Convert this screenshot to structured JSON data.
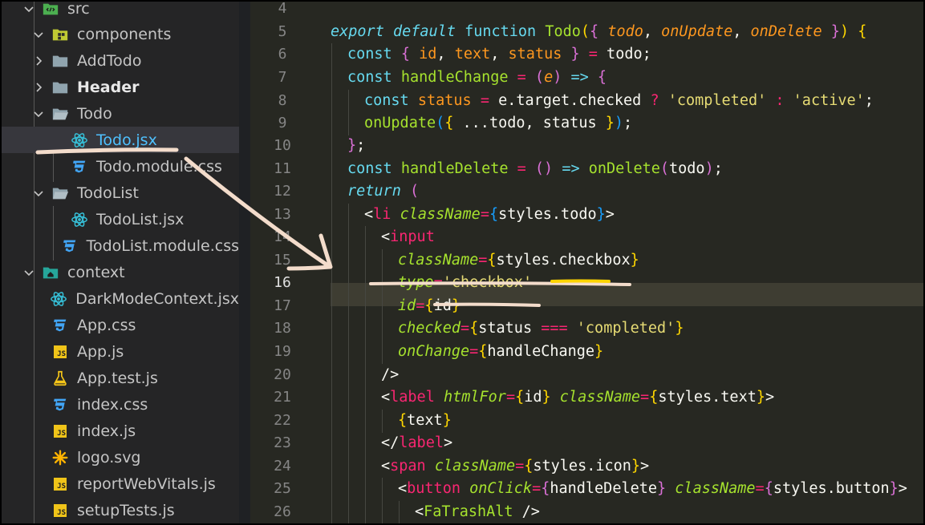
{
  "explorer": {
    "items": [
      {
        "label": "src",
        "chevron": "down",
        "icon": "src-folder-icon"
      },
      {
        "label": "components",
        "chevron": "down",
        "icon": "components-folder-icon"
      },
      {
        "label": "AddTodo",
        "chevron": "right",
        "icon": "folder-icon"
      },
      {
        "label": "Header",
        "chevron": "right",
        "icon": "folder-icon"
      },
      {
        "label": "Todo",
        "chevron": "down",
        "icon": "folder-open-icon"
      },
      {
        "label": "Todo.jsx",
        "chevron": "",
        "icon": "react-icon"
      },
      {
        "label": "Todo.module.css",
        "chevron": "",
        "icon": "css-icon"
      },
      {
        "label": "TodoList",
        "chevron": "down",
        "icon": "folder-open-icon"
      },
      {
        "label": "TodoList.jsx",
        "chevron": "",
        "icon": "react-icon"
      },
      {
        "label": "TodoList.module.css",
        "chevron": "",
        "icon": "css-icon"
      },
      {
        "label": "context",
        "chevron": "down",
        "icon": "context-folder-icon"
      },
      {
        "label": "DarkModeContext.jsx",
        "chevron": "",
        "icon": "react-icon"
      },
      {
        "label": "App.css",
        "chevron": "",
        "icon": "css-icon"
      },
      {
        "label": "App.js",
        "chevron": "",
        "icon": "js-icon"
      },
      {
        "label": "App.test.js",
        "chevron": "",
        "icon": "test-flask-icon"
      },
      {
        "label": "index.css",
        "chevron": "",
        "icon": "css-icon"
      },
      {
        "label": "index.js",
        "chevron": "",
        "icon": "js-icon"
      },
      {
        "label": "logo.svg",
        "chevron": "",
        "icon": "svg-asterisk-icon"
      },
      {
        "label": "reportWebVitals.js",
        "chevron": "",
        "icon": "js-icon"
      },
      {
        "label": "setupTests.js",
        "chevron": "",
        "icon": "js-icon"
      }
    ],
    "selected_item": "Todo.jsx",
    "js_badge": "JS"
  },
  "editor": {
    "active_line": "16",
    "lines": [
      {
        "num": "4",
        "tokens": []
      },
      {
        "num": "5",
        "tokens": [
          [
            "kwi",
            "export"
          ],
          [
            "txt",
            " "
          ],
          [
            "kwi",
            "default"
          ],
          [
            "txt",
            " "
          ],
          [
            "kw",
            "function"
          ],
          [
            "txt",
            " "
          ],
          [
            "fn",
            "Todo"
          ],
          [
            "br1",
            "("
          ],
          [
            "br2",
            "{"
          ],
          [
            "txt",
            " "
          ],
          [
            "prmi",
            "todo"
          ],
          [
            "txt",
            ", "
          ],
          [
            "prmi",
            "onUpdate"
          ],
          [
            "txt",
            ", "
          ],
          [
            "prmi",
            "onDelete"
          ],
          [
            "txt",
            " "
          ],
          [
            "br2",
            "}"
          ],
          [
            "br1",
            ")"
          ],
          [
            "txt",
            " "
          ],
          [
            "br1",
            "{"
          ]
        ]
      },
      {
        "num": "6",
        "tokens": [
          [
            "kw",
            "const"
          ],
          [
            "txt",
            " "
          ],
          [
            "br2",
            "{"
          ],
          [
            "txt",
            " "
          ],
          [
            "prm",
            "id"
          ],
          [
            "txt",
            ", "
          ],
          [
            "prm",
            "text"
          ],
          [
            "txt",
            ", "
          ],
          [
            "prm",
            "status"
          ],
          [
            "txt",
            " "
          ],
          [
            "br2",
            "}"
          ],
          [
            "txt",
            " "
          ],
          [
            "op",
            "="
          ],
          [
            "txt",
            " todo;"
          ]
        ]
      },
      {
        "num": "7",
        "tokens": [
          [
            "kw",
            "const"
          ],
          [
            "txt",
            " "
          ],
          [
            "fn",
            "handleChange"
          ],
          [
            "txt",
            " "
          ],
          [
            "op",
            "="
          ],
          [
            "txt",
            " "
          ],
          [
            "br2",
            "("
          ],
          [
            "prmi",
            "e"
          ],
          [
            "br2",
            ")"
          ],
          [
            "txt",
            " "
          ],
          [
            "kw",
            "=>"
          ],
          [
            "txt",
            " "
          ],
          [
            "br2",
            "{"
          ]
        ]
      },
      {
        "num": "8",
        "tokens": [
          [
            "kw",
            "const"
          ],
          [
            "txt",
            " "
          ],
          [
            "prm",
            "status"
          ],
          [
            "txt",
            " "
          ],
          [
            "op",
            "="
          ],
          [
            "txt",
            " e.target.checked "
          ],
          [
            "op",
            "?"
          ],
          [
            "txt",
            " "
          ],
          [
            "str",
            "'completed'"
          ],
          [
            "txt",
            " "
          ],
          [
            "op",
            ":"
          ],
          [
            "txt",
            " "
          ],
          [
            "str",
            "'active'"
          ],
          [
            "txt",
            ";"
          ]
        ]
      },
      {
        "num": "9",
        "tokens": [
          [
            "fn",
            "onUpdate"
          ],
          [
            "br3",
            "("
          ],
          [
            "br1",
            "{"
          ],
          [
            "txt",
            " ...todo, status "
          ],
          [
            "br1",
            "}"
          ],
          [
            "br3",
            ")"
          ],
          [
            "txt",
            ";"
          ]
        ]
      },
      {
        "num": "10",
        "tokens": [
          [
            "br2",
            "}"
          ],
          [
            "txt",
            ";"
          ]
        ]
      },
      {
        "num": "11",
        "tokens": [
          [
            "kw",
            "const"
          ],
          [
            "txt",
            " "
          ],
          [
            "fn",
            "handleDelete"
          ],
          [
            "txt",
            " "
          ],
          [
            "op",
            "="
          ],
          [
            "txt",
            " "
          ],
          [
            "br2",
            "()"
          ],
          [
            "txt",
            " "
          ],
          [
            "kw",
            "=>"
          ],
          [
            "txt",
            " "
          ],
          [
            "fn",
            "onDelete"
          ],
          [
            "br2",
            "("
          ],
          [
            "txt",
            "todo"
          ],
          [
            "br2",
            ")"
          ],
          [
            "txt",
            ";"
          ]
        ]
      },
      {
        "num": "12",
        "tokens": [
          [
            "kwi",
            "return"
          ],
          [
            "txt",
            " "
          ],
          [
            "br2",
            "("
          ]
        ]
      },
      {
        "num": "13",
        "tokens": [
          [
            "txt",
            "<"
          ],
          [
            "tag",
            "li"
          ],
          [
            "txt",
            " "
          ],
          [
            "attr",
            "className"
          ],
          [
            "op",
            "="
          ],
          [
            "br3",
            "{"
          ],
          [
            "txt",
            "styles.todo"
          ],
          [
            "br3",
            "}"
          ],
          [
            "txt",
            ">"
          ]
        ]
      },
      {
        "num": "14",
        "tokens": [
          [
            "txt",
            "<"
          ],
          [
            "tag",
            "input"
          ]
        ]
      },
      {
        "num": "15",
        "tokens": [
          [
            "attr",
            "className"
          ],
          [
            "op",
            "="
          ],
          [
            "br1",
            "{"
          ],
          [
            "txt",
            "styles.checkbox"
          ],
          [
            "br1",
            "}"
          ]
        ]
      },
      {
        "num": "16",
        "tokens": [
          [
            "attr",
            "type"
          ],
          [
            "op",
            "="
          ],
          [
            "str",
            "'checkbox'"
          ]
        ]
      },
      {
        "num": "17",
        "tokens": [
          [
            "attr",
            "id"
          ],
          [
            "op",
            "="
          ],
          [
            "br1",
            "{"
          ],
          [
            "txt",
            "id"
          ],
          [
            "br1",
            "}"
          ]
        ]
      },
      {
        "num": "18",
        "tokens": [
          [
            "attr",
            "checked"
          ],
          [
            "op",
            "="
          ],
          [
            "br1",
            "{"
          ],
          [
            "txt",
            "status "
          ],
          [
            "op",
            "==="
          ],
          [
            "txt",
            " "
          ],
          [
            "str",
            "'completed'"
          ],
          [
            "br1",
            "}"
          ]
        ]
      },
      {
        "num": "19",
        "tokens": [
          [
            "attr",
            "onChange"
          ],
          [
            "op",
            "="
          ],
          [
            "br1",
            "{"
          ],
          [
            "txt",
            "handleChange"
          ],
          [
            "br1",
            "}"
          ]
        ]
      },
      {
        "num": "20",
        "tokens": [
          [
            "txt",
            "/>"
          ]
        ]
      },
      {
        "num": "21",
        "tokens": [
          [
            "txt",
            "<"
          ],
          [
            "tag",
            "label"
          ],
          [
            "txt",
            " "
          ],
          [
            "attr",
            "htmlFor"
          ],
          [
            "op",
            "="
          ],
          [
            "br1",
            "{"
          ],
          [
            "txt",
            "id"
          ],
          [
            "br1",
            "}"
          ],
          [
            "txt",
            " "
          ],
          [
            "attr",
            "className"
          ],
          [
            "op",
            "="
          ],
          [
            "br1",
            "{"
          ],
          [
            "txt",
            "styles.text"
          ],
          [
            "br1",
            "}"
          ],
          [
            "txt",
            ">"
          ]
        ]
      },
      {
        "num": "22",
        "tokens": [
          [
            "br1",
            "{"
          ],
          [
            "txt",
            "text"
          ],
          [
            "br1",
            "}"
          ]
        ]
      },
      {
        "num": "23",
        "tokens": [
          [
            "txt",
            "</"
          ],
          [
            "tag",
            "label"
          ],
          [
            "txt",
            ">"
          ]
        ]
      },
      {
        "num": "24",
        "tokens": [
          [
            "txt",
            "<"
          ],
          [
            "tag",
            "span"
          ],
          [
            "txt",
            " "
          ],
          [
            "attr",
            "className"
          ],
          [
            "op",
            "="
          ],
          [
            "br1",
            "{"
          ],
          [
            "txt",
            "styles.icon"
          ],
          [
            "br1",
            "}"
          ],
          [
            "txt",
            ">"
          ]
        ]
      },
      {
        "num": "25",
        "tokens": [
          [
            "txt",
            "<"
          ],
          [
            "tag",
            "button"
          ],
          [
            "txt",
            " "
          ],
          [
            "attr",
            "onClick"
          ],
          [
            "op",
            "="
          ],
          [
            "br2",
            "{"
          ],
          [
            "txt",
            "handleDelete"
          ],
          [
            "br2",
            "}"
          ],
          [
            "txt",
            " "
          ],
          [
            "attr",
            "className"
          ],
          [
            "op",
            "="
          ],
          [
            "br2",
            "{"
          ],
          [
            "txt",
            "styles.button"
          ],
          [
            "br2",
            "}"
          ],
          [
            "txt",
            ">"
          ]
        ]
      },
      {
        "num": "26",
        "tokens": [
          [
            "txt",
            "<"
          ],
          [
            "fn",
            "FaTrashAlt"
          ],
          [
            "txt",
            " />"
          ]
        ]
      }
    ]
  },
  "colors": {
    "annotation": "#f3dccb",
    "highlight_underline": "#ffd400"
  }
}
